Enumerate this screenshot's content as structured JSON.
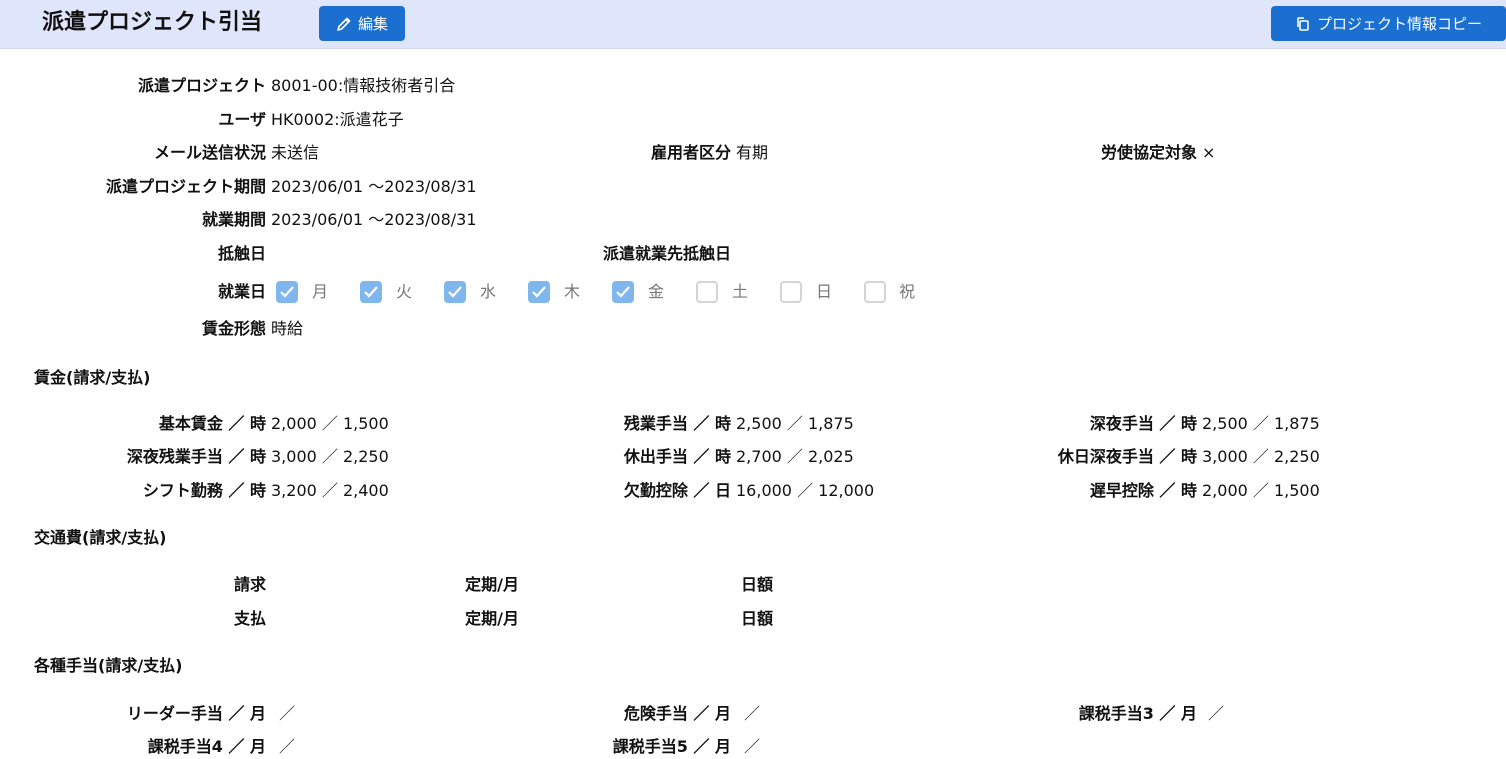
{
  "header": {
    "title": "派遣プロジェクト引当",
    "edit_label": "編集",
    "copy_label": "プロジェクト情報コピー"
  },
  "info": {
    "project_label": "派遣プロジェクト",
    "project_value": "8001-00:情報技術者引合",
    "user_label": "ユーザ",
    "user_value": "HK0002:派遣花子",
    "mail_label": "メール送信状況",
    "mail_value": "未送信",
    "employment_label": "雇用者区分",
    "employment_value": "有期",
    "labor_label": "労使協定対象",
    "labor_value": "×",
    "period_label": "派遣プロジェクト期間",
    "period_value": "2023/06/01 ～2023/08/31",
    "work_period_label": "就業期間",
    "work_period_value": "2023/06/01 ～2023/08/31",
    "conflict_label": "抵触日",
    "dest_conflict_label": "派遣就業先抵触日",
    "workdays_label": "就業日",
    "wage_type_label": "賃金形態",
    "wage_type_value": "時給"
  },
  "workdays": [
    {
      "label": "月",
      "checked": true
    },
    {
      "label": "火",
      "checked": true
    },
    {
      "label": "水",
      "checked": true
    },
    {
      "label": "木",
      "checked": true
    },
    {
      "label": "金",
      "checked": true
    },
    {
      "label": "土",
      "checked": false
    },
    {
      "label": "日",
      "checked": false
    },
    {
      "label": "祝",
      "checked": false
    }
  ],
  "wages": {
    "title": "賃金(請求/支払)",
    "rows": [
      {
        "label": "基本賃金 ／ 時",
        "value": "2,000 ／ 1,500"
      },
      {
        "label": "残業手当 ／ 時",
        "value": "2,500 ／ 1,875"
      },
      {
        "label": "深夜手当 ／ 時",
        "value": "2,500 ／ 1,875"
      },
      {
        "label": "深夜残業手当 ／ 時",
        "value": "3,000 ／ 2,250"
      },
      {
        "label": "休出手当 ／ 時",
        "value": "2,700 ／ 2,025"
      },
      {
        "label": "休日深夜手当 ／ 時",
        "value": "3,000 ／ 2,250"
      },
      {
        "label": "シフト勤務 ／ 時",
        "value": "3,200 ／ 2,400"
      },
      {
        "label": "欠勤控除 ／ 日",
        "value": "16,000 ／ 12,000"
      },
      {
        "label": "遅早控除 ／ 時",
        "value": "2,000 ／ 1,500"
      }
    ]
  },
  "transport": {
    "title": "交通費(請求/支払)",
    "billing_label": "請求",
    "payment_label": "支払",
    "billing_pass_label": "定期/月",
    "billing_daily_label": "日額",
    "payment_pass_label": "定期/月",
    "payment_daily_label": "日額"
  },
  "allowances": {
    "title": "各種手当(請求/支払)",
    "rows": [
      {
        "label": "リーダー手当 ／ 月",
        "value": "／"
      },
      {
        "label": "危険手当 ／ 月",
        "value": "／"
      },
      {
        "label": "課税手当3 ／ 月",
        "value": "／"
      },
      {
        "label": "課税手当4 ／ 月",
        "value": "／"
      },
      {
        "label": "課税手当5 ／ 月",
        "value": "／"
      }
    ]
  }
}
